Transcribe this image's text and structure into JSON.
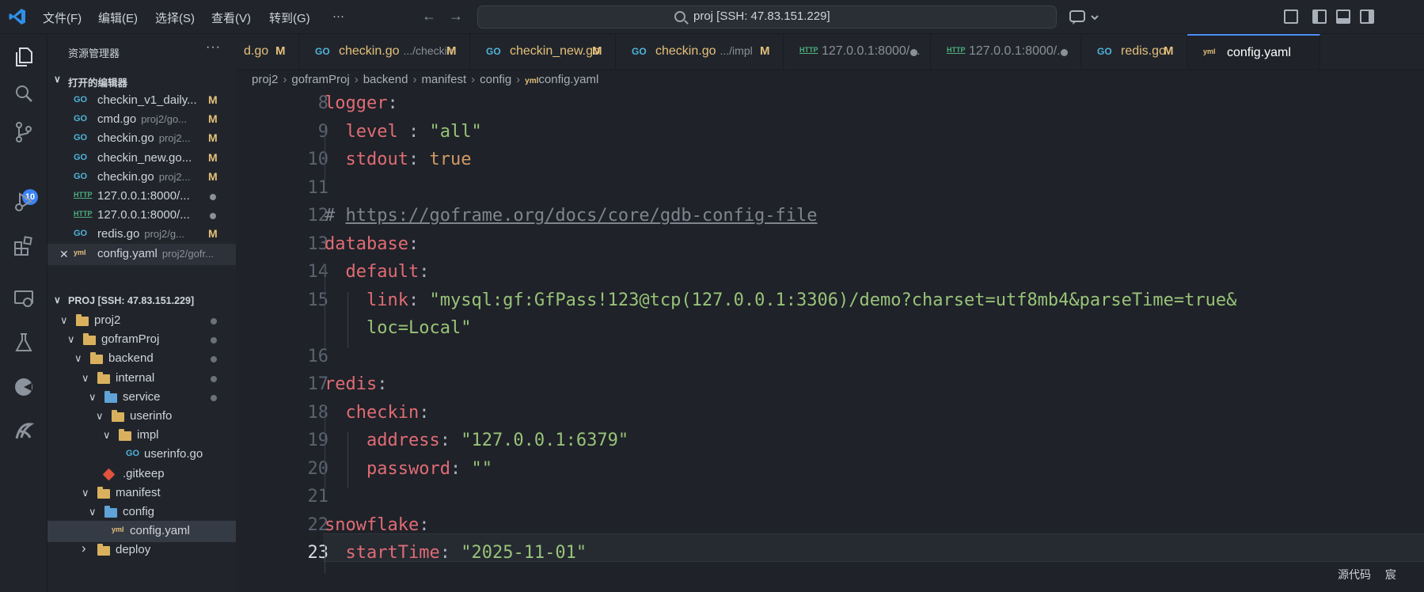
{
  "colors": {
    "accent": "#4d8ef7",
    "modified": "#e5c07b",
    "go_icon": "#4fb3d9",
    "folder": "#d9b15e",
    "badge": "#3b82f6"
  },
  "titlebar": {
    "menu": [
      "文件(F)",
      "编辑(E)",
      "选择(S)",
      "查看(V)",
      "转到(G)",
      "···"
    ],
    "search_text": "proj [SSH: 47.83.151.229]",
    "icons": [
      "vscode-logo-icon",
      "back-arrow-icon",
      "forward-arrow-icon",
      "copilot-icon",
      "layout-icons"
    ]
  },
  "activity": {
    "scm_badge": "10"
  },
  "sidebar": {
    "title": "资源管理器",
    "more": "···",
    "open_editors_label": "打开的编辑器",
    "open_editors": [
      {
        "icon": "GO",
        "name": "checkin_v1_daily...",
        "desc": "",
        "status": "M"
      },
      {
        "icon": "GO",
        "name": "cmd.go",
        "desc": "proj2/go...",
        "status": "M"
      },
      {
        "icon": "GO",
        "name": "checkin.go",
        "desc": "proj2...",
        "status": "M"
      },
      {
        "icon": "GO",
        "name": "checkin_new.go...",
        "desc": "",
        "status": "M"
      },
      {
        "icon": "GO",
        "name": "checkin.go",
        "desc": "proj2...",
        "status": "M"
      },
      {
        "icon": "HTTP",
        "name": "127.0.0.1:8000/...",
        "desc": "",
        "status": "dot"
      },
      {
        "icon": "HTTP",
        "name": "127.0.0.1:8000/...",
        "desc": "",
        "status": "dot"
      },
      {
        "icon": "GO",
        "name": "redis.go",
        "desc": "proj2/g...",
        "status": "M"
      },
      {
        "icon": "YAML",
        "name": "config.yaml",
        "desc": "proj2/gofr...",
        "status": "close"
      }
    ],
    "project_label": "PROJ [SSH: 47.83.151.229]",
    "tree": [
      {
        "name": "proj2",
        "depth": 0,
        "type": "folder",
        "open": true,
        "dot": true
      },
      {
        "name": "goframProj",
        "depth": 1,
        "type": "folder",
        "open": true,
        "dot": true
      },
      {
        "name": "backend",
        "depth": 2,
        "type": "folder",
        "open": true,
        "dot": true
      },
      {
        "name": "internal",
        "depth": 3,
        "type": "folder",
        "open": true,
        "dot": true
      },
      {
        "name": "service",
        "depth": 4,
        "type": "folder-blue",
        "open": true,
        "dot": true
      },
      {
        "name": "userinfo",
        "depth": 5,
        "type": "folder",
        "open": true,
        "dot": false
      },
      {
        "name": "impl",
        "depth": 6,
        "type": "folder",
        "open": true,
        "dot": false
      },
      {
        "name": "userinfo.go",
        "depth": 7,
        "type": "go",
        "dot": false
      },
      {
        "name": ".gitkeep",
        "depth": 4,
        "type": "git",
        "dot": false
      },
      {
        "name": "manifest",
        "depth": 3,
        "type": "folder",
        "open": true,
        "dot": false
      },
      {
        "name": "config",
        "depth": 4,
        "type": "folder-blue",
        "open": true,
        "dot": false
      },
      {
        "name": "config.yaml",
        "depth": 5,
        "type": "yaml",
        "dot": false
      },
      {
        "name": "deploy",
        "depth": 3,
        "type": "folder",
        "open": false,
        "dot": false
      }
    ]
  },
  "tabs": [
    {
      "icon": "",
      "name": "d.go",
      "desc": "",
      "status": "M"
    },
    {
      "icon": "GO",
      "name": "checkin.go",
      "desc": ".../checkin",
      "status": "M"
    },
    {
      "icon": "GO",
      "name": "checkin_new.go",
      "desc": "",
      "status": "M"
    },
    {
      "icon": "GO",
      "name": "checkin.go",
      "desc": ".../impl",
      "status": "M"
    },
    {
      "icon": "HTTP",
      "name": "127.0.0.1:8000/...",
      "desc": "",
      "status": "dot"
    },
    {
      "icon": "HTTP",
      "name": "127.0.0.1:8000/...",
      "desc": "",
      "status": "dot"
    },
    {
      "icon": "GO",
      "name": "redis.go",
      "desc": "",
      "status": "M"
    },
    {
      "icon": "YAML",
      "name": "config.yaml",
      "desc": "",
      "status": "",
      "active": true
    }
  ],
  "breadcrumb": [
    "proj2",
    "goframProj",
    "backend",
    "manifest",
    "config",
    "config.yaml"
  ],
  "editor": {
    "current_line": "23",
    "lines": [
      {
        "n": "8",
        "tokens": [
          [
            "k",
            "logger"
          ],
          [
            "p",
            ":"
          ]
        ]
      },
      {
        "n": "9",
        "tokens": [
          [
            "p",
            "  "
          ],
          [
            "k",
            "level"
          ],
          [
            "p",
            " : "
          ],
          [
            "s",
            "\"all\""
          ]
        ]
      },
      {
        "n": "10",
        "tokens": [
          [
            "p",
            "  "
          ],
          [
            "k",
            "stdout"
          ],
          [
            "p",
            ": "
          ],
          [
            "b",
            "true"
          ]
        ]
      },
      {
        "n": "11",
        "tokens": []
      },
      {
        "n": "12",
        "tokens": [
          [
            "c",
            "# "
          ],
          [
            "u",
            "https://goframe.org/docs/core/gdb-config-file"
          ]
        ]
      },
      {
        "n": "13",
        "tokens": [
          [
            "k",
            "database"
          ],
          [
            "p",
            ":"
          ]
        ]
      },
      {
        "n": "14",
        "tokens": [
          [
            "p",
            "  "
          ],
          [
            "k",
            "default"
          ],
          [
            "p",
            ":"
          ]
        ]
      },
      {
        "n": "15",
        "tokens": [
          [
            "p",
            "    "
          ],
          [
            "k",
            "link"
          ],
          [
            "p",
            ": "
          ],
          [
            "s",
            "\"mysql:gf:GfPass!123@tcp(127.0.0.1:3306)/demo?charset=utf8mb4&parseTime=true&"
          ]
        ]
      },
      {
        "n": "",
        "tokens": [
          [
            "p",
            "    "
          ],
          [
            "s",
            "loc=Local\""
          ]
        ]
      },
      {
        "n": "16",
        "tokens": []
      },
      {
        "n": "17",
        "tokens": [
          [
            "k",
            "redis"
          ],
          [
            "p",
            ":"
          ]
        ]
      },
      {
        "n": "18",
        "tokens": [
          [
            "p",
            "  "
          ],
          [
            "k",
            "checkin"
          ],
          [
            "p",
            ":"
          ]
        ]
      },
      {
        "n": "19",
        "tokens": [
          [
            "p",
            "    "
          ],
          [
            "k",
            "address"
          ],
          [
            "p",
            ": "
          ],
          [
            "s",
            "\"127.0.0.1:6379\""
          ]
        ]
      },
      {
        "n": "20",
        "tokens": [
          [
            "p",
            "    "
          ],
          [
            "k",
            "password"
          ],
          [
            "p",
            ": "
          ],
          [
            "s",
            "\"\""
          ]
        ]
      },
      {
        "n": "21",
        "tokens": []
      },
      {
        "n": "22",
        "tokens": [
          [
            "k",
            "snowflake"
          ],
          [
            "p",
            ":"
          ]
        ]
      },
      {
        "n": "23",
        "tokens": [
          [
            "p",
            "  "
          ],
          [
            "k",
            "startTime"
          ],
          [
            "p",
            ": "
          ],
          [
            "s",
            "\"2025-11-01\""
          ]
        ]
      }
    ]
  },
  "status": {
    "left": "源代码",
    "right": "宸"
  }
}
